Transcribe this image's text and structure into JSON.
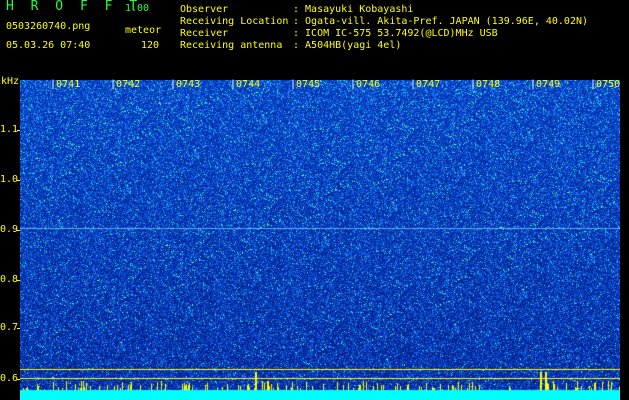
{
  "header": {
    "app_name": "H R O F F T",
    "version": "1.00",
    "filename": "0503260740.png",
    "mode_label": "meteor",
    "datetime": "05.03.26 07:40",
    "count": "120"
  },
  "info": [
    {
      "label": "Observer",
      "value": ": Masayuki Kobayashi"
    },
    {
      "label": "Receiving Location",
      "value": ": Ogata-vill. Akita-Pref. JAPAN (139.96E, 40.02N)"
    },
    {
      "label": "Receiver",
      "value": ": ICOM IC-575 53.7492(@LCD)MHz USB"
    },
    {
      "label": "Receiving antenna",
      "value": ": A504HB(yagi 4el)"
    }
  ],
  "axis": {
    "y_unit": "kHz",
    "y_ticks": [
      "1.1",
      "1.0",
      "0.9",
      "0.8",
      "0.7",
      "0.6"
    ],
    "x_ticks": [
      "0741",
      "0742",
      "0743",
      "0744",
      "0745",
      "0746",
      "0747",
      "0748",
      "0749",
      "0750"
    ]
  },
  "colors": {
    "background": "#000000",
    "label_yellow": "#ffff00",
    "title_green": "#22ff44",
    "spectrum_base": "#0a2fb0",
    "baseline_cyan": "#00ffff"
  }
}
